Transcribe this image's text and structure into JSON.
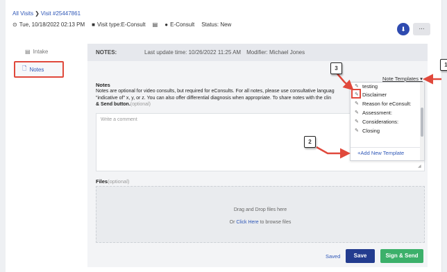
{
  "breadcrumb": {
    "root": "All Visits",
    "separator": "❯",
    "current": "Visit #25447861"
  },
  "visit_meta": {
    "date": "Tue, 10/18/2022 02:13 PM",
    "visit_type": "Visit type:E-Consult",
    "econsult": "E-Consult",
    "status": "Status: New"
  },
  "header_actions": {
    "download_label": "⬇",
    "more_label": "..."
  },
  "sidebar": {
    "items": [
      {
        "label": "Intake",
        "icon": "list-icon",
        "active": false
      },
      {
        "label": "Notes",
        "icon": "file-icon",
        "active": true
      }
    ]
  },
  "notes_bar": {
    "label": "NOTES:",
    "last_update": "Last update time: 10/26/2022 11:25 AM",
    "modifier": "Modifier: Michael Jones"
  },
  "note_templates": {
    "link_label": "Note Templates",
    "items": [
      "testing",
      "Disclaimer",
      "Reason for eConsult:",
      "Assessment:",
      "Considerations:",
      "Closing"
    ],
    "add_label": "Add New Template"
  },
  "notes_section": {
    "title": "Notes",
    "line1": "Notes are optional for video consults, but required for eConsults. For all notes, please use consultative languag",
    "line2": "\"indicative of\" x, y, or z. You can also offer differential diagnosis when appropriate. To share notes with the clin",
    "line3_bold": "& Send button.",
    "line3_optional": "(optional)",
    "comment_placeholder": "Write a comment"
  },
  "files_section": {
    "label": "Files",
    "optional": "(optional)",
    "drop_text": "Drag and Drop files here",
    "or_text": "Or ",
    "click_here": "Click Here",
    "browse_text": " to browse files"
  },
  "footer": {
    "saved": "Saved",
    "save": "Save",
    "sign_send": "Sign & Send"
  },
  "annotations": {
    "badge1": "1",
    "badge2": "2",
    "badge3": "3"
  },
  "colors": {
    "accent_blue": "#2f57b7",
    "save_button": "#233c8f",
    "sign_send": "#3cb06a",
    "annotation_red": "#e0483b"
  }
}
